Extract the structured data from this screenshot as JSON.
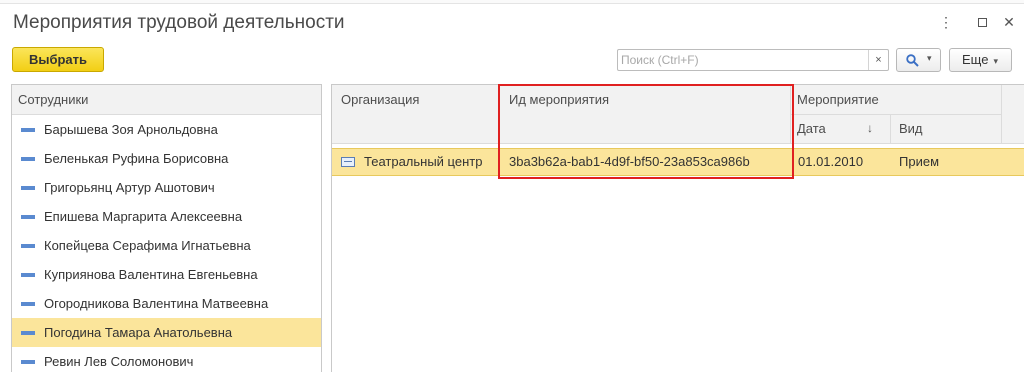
{
  "window": {
    "title": "Мероприятия трудовой деятельности"
  },
  "toolbar": {
    "select_label": "Выбрать",
    "search_placeholder": "Поиск (Ctrl+F)",
    "more_label": "Еще"
  },
  "icons": {
    "more": "vertical-dots-icon",
    "maximize": "maximize-icon",
    "close": "close-icon",
    "search": "magnifier-icon",
    "clear": "clear-x-icon"
  },
  "colors": {
    "accent_yellow": "#f2cf14",
    "selection": "#fbe59b",
    "employee_marker": "#5a8ad0",
    "highlight_frame": "#e02020"
  },
  "employees": {
    "header": "Сотрудники",
    "items": [
      "Барышева Зоя Арнольдовна",
      "Беленькая Руфина Борисовна",
      "Григорьянц Артур Ашотович",
      "Епишева Маргарита Алексеевна",
      "Копейцева Серафима Игнатьевна",
      "Куприянова Валентина Евгеньевна",
      "Огородникова Валентина Матвеевна",
      "Погодина Тамара Анатольевна",
      "Ревин Лев Соломонович"
    ],
    "selected_index": 7
  },
  "events": {
    "columns": {
      "organization": "Организация",
      "event_id": "Ид мероприятия",
      "event": "Мероприятие",
      "date": "Дата",
      "type": "Вид"
    },
    "sort_indicator": "↓",
    "rows": [
      {
        "organization": "Театральный центр",
        "event_id": "3ba3b62a-bab1-4d9f-bf50-23a853ca986b",
        "date": "01.01.2010",
        "type": "Прием"
      }
    ]
  }
}
